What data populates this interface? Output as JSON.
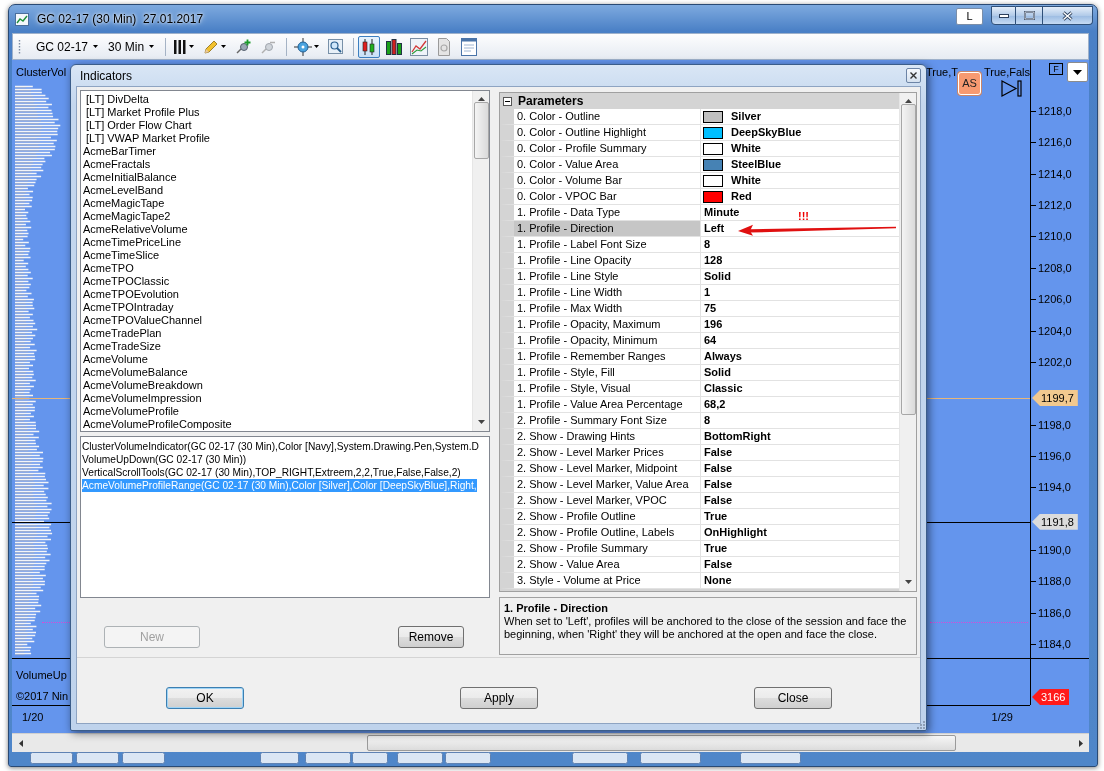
{
  "window": {
    "title": "GC 02-17 (30 Min)  27.01.2017",
    "button": "L"
  },
  "toolbar": {
    "symbol": "GC 02-17",
    "interval": "30 Min",
    "toggles": [
      {
        "selected": true
      },
      {
        "selected": false
      },
      {
        "selected": false
      },
      {
        "selected": false
      },
      {
        "selected": false
      }
    ]
  },
  "chart": {
    "indicator_label": "ClusterVol",
    "overlay_labels": [
      "True,T",
      "True,Fals"
    ],
    "badge": "AS",
    "axis_button": "F",
    "price_ticks": [
      "1218,0",
      "1216,0",
      "1214,0",
      "1212,0",
      "1210,0",
      "1208,0",
      "1206,0",
      "1204,0",
      "1202,0",
      "1198,0",
      "1196,0",
      "1194,0",
      "1190,0",
      "1188,0",
      "1186,0",
      "1184,0"
    ],
    "price_markers": [
      {
        "kind": "main",
        "value": "1199,7",
        "color": "#f2c98f",
        "line": {
          "color": "#e6b67a"
        }
      },
      {
        "kind": "main",
        "value": "1191,8",
        "color": "#dcdcdc",
        "line": {
          "color": "#000000"
        }
      },
      {
        "kind": "lower",
        "value": "3166",
        "color": "#ff1a1a"
      }
    ],
    "lower_pane": {
      "label": "VolumeUp",
      "copyright": "©2017 Nin"
    },
    "date_labels": [
      "1/20",
      "1/29"
    ]
  },
  "dialog": {
    "title": "Indicators",
    "available": [
      {
        "label": " [LT] DivDelta",
        "selected": false
      },
      {
        "label": " [LT] Market Profile Plus",
        "selected": false
      },
      {
        "label": " [LT] Order Flow Chart",
        "selected": false
      },
      {
        "label": " [LT] VWAP Market Profile",
        "selected": false
      },
      {
        "label": "AcmeBarTimer",
        "selected": false
      },
      {
        "label": "AcmeFractals",
        "selected": false
      },
      {
        "label": "AcmeInitialBalance",
        "selected": false
      },
      {
        "label": "AcmeLevelBand",
        "selected": false
      },
      {
        "label": "AcmeMagicTape",
        "selected": false
      },
      {
        "label": "AcmeMagicTape2",
        "selected": false
      },
      {
        "label": "AcmeRelativeVolume",
        "selected": false
      },
      {
        "label": "AcmeTimePriceLine",
        "selected": false
      },
      {
        "label": "AcmeTimeSlice",
        "selected": false
      },
      {
        "label": "AcmeTPO",
        "selected": false
      },
      {
        "label": "AcmeTPOClassic",
        "selected": false
      },
      {
        "label": "AcmeTPOEvolution",
        "selected": false
      },
      {
        "label": "AcmeTPOIntraday",
        "selected": false
      },
      {
        "label": "AcmeTPOValueChannel",
        "selected": false
      },
      {
        "label": "AcmeTradePlan",
        "selected": false
      },
      {
        "label": "AcmeTradeSize",
        "selected": false
      },
      {
        "label": "AcmeVolume",
        "selected": false
      },
      {
        "label": "AcmeVolumeBalance",
        "selected": false
      },
      {
        "label": "AcmeVolumeBreakdown",
        "selected": false
      },
      {
        "label": "AcmeVolumeImpression",
        "selected": false
      },
      {
        "label": "AcmeVolumeProfile",
        "selected": false
      },
      {
        "label": "AcmeVolumeProfileComposite",
        "selected": false
      }
    ],
    "applied": [
      {
        "label": "ClusterVolumeIndicator(GC 02-17 (30 Min),Color [Navy],System.Drawing.Pen,System.D",
        "selected": false
      },
      {
        "label": "VolumeUpDown(GC 02-17 (30 Min))",
        "selected": false
      },
      {
        "label": "VerticalScrollTools(GC 02-17 (30 Min),TOP_RIGHT,Extreem,2,2,True,False,False,2)",
        "selected": false
      },
      {
        "label": "AcmeVolumeProfileRange(GC 02-17 (30 Min),Color [Silver],Color [DeepSkyBlue],Right,",
        "selected": true
      }
    ],
    "list_buttons": [
      {
        "label": "New",
        "disabled": true
      },
      {
        "label": "Remove",
        "disabled": false
      }
    ],
    "parameters": {
      "category": "Parameters",
      "expanded": true,
      "rows": [
        {
          "name": "0. Color - Outline",
          "value": "Silver",
          "kind": "color",
          "color": "#c0c0c0",
          "selected": false
        },
        {
          "name": "0. Color - Outline Highlight",
          "value": "DeepSkyBlue",
          "kind": "color",
          "color": "#00bfff",
          "selected": false
        },
        {
          "name": "0. Color - Profile Summary",
          "value": "White",
          "kind": "color",
          "color": "#ffffff",
          "selected": false
        },
        {
          "name": "0. Color - Value Area",
          "value": "SteelBlue",
          "kind": "color",
          "color": "#4682b4",
          "selected": false
        },
        {
          "name": "0. Color - Volume Bar",
          "value": "White",
          "kind": "color",
          "color": "#ffffff",
          "selected": false
        },
        {
          "name": "0. Color - VPOC Bar",
          "value": "Red",
          "kind": "color",
          "color": "#ff0000",
          "selected": false
        },
        {
          "name": "1. Profile - Data Type",
          "value": "Minute",
          "kind": "text",
          "selected": false
        },
        {
          "name": "1. Profile - Direction",
          "value": "Left",
          "kind": "text",
          "selected": true
        },
        {
          "name": "1. Profile - Label Font Size",
          "value": "8",
          "kind": "text",
          "selected": false
        },
        {
          "name": "1. Profile - Line Opacity",
          "value": "128",
          "kind": "text",
          "selected": false
        },
        {
          "name": "1. Profile - Line Style",
          "value": "Solid",
          "kind": "text",
          "selected": false
        },
        {
          "name": "1. Profile - Line Width",
          "value": "1",
          "kind": "text",
          "selected": false
        },
        {
          "name": "1. Profile - Max Width",
          "value": "75",
          "kind": "text",
          "selected": false
        },
        {
          "name": "1. Profile - Opacity, Maximum",
          "value": "196",
          "kind": "text",
          "selected": false
        },
        {
          "name": "1. Profile - Opacity, Minimum",
          "value": "64",
          "kind": "text",
          "selected": false
        },
        {
          "name": "1. Profile - Remember Ranges",
          "value": "Always",
          "kind": "text",
          "selected": false
        },
        {
          "name": "1. Profile - Style, Fill",
          "value": "Solid",
          "kind": "text",
          "selected": false
        },
        {
          "name": "1. Profile - Style, Visual",
          "value": "Classic",
          "kind": "text",
          "selected": false
        },
        {
          "name": "1. Profile - Value Area Percentage",
          "value": "68,2",
          "kind": "text",
          "selected": false
        },
        {
          "name": "2. Profile - Summary Font Size",
          "value": "8",
          "kind": "text",
          "selected": false
        },
        {
          "name": "2. Show - Drawing Hints",
          "value": "BottomRight",
          "kind": "text",
          "selected": false
        },
        {
          "name": "2. Show - Level Marker Prices",
          "value": "False",
          "kind": "text",
          "selected": false
        },
        {
          "name": "2. Show - Level Marker, Midpoint",
          "value": "False",
          "kind": "text",
          "selected": false
        },
        {
          "name": "2. Show - Level Marker, Value Area",
          "value": "False",
          "kind": "text",
          "selected": false
        },
        {
          "name": "2. Show - Level Marker, VPOC",
          "value": "False",
          "kind": "text",
          "selected": false
        },
        {
          "name": "2. Show - Profile Outline",
          "value": "True",
          "kind": "text",
          "selected": false
        },
        {
          "name": "2. Show - Profile Outline, Labels",
          "value": "OnHighlight",
          "kind": "text",
          "selected": false
        },
        {
          "name": "2. Show - Profile Summary",
          "value": "True",
          "kind": "text",
          "selected": false
        },
        {
          "name": "2. Show - Value Area",
          "value": "False",
          "kind": "text",
          "selected": false
        },
        {
          "name": "3. Style - Volume at Price",
          "value": "None",
          "kind": "text",
          "selected": false
        }
      ]
    },
    "annotation": {
      "text": "!!!"
    },
    "description": {
      "title": "1. Profile - Direction",
      "text": "When set to 'Left', profiles will be anchored to the close of the session and face the beginning, when 'Right' they will be anchored at the open and face the close."
    },
    "footer_buttons": [
      {
        "label": "OK",
        "default": true
      },
      {
        "label": "Apply",
        "default": false
      },
      {
        "label": "Close",
        "default": false
      }
    ]
  }
}
